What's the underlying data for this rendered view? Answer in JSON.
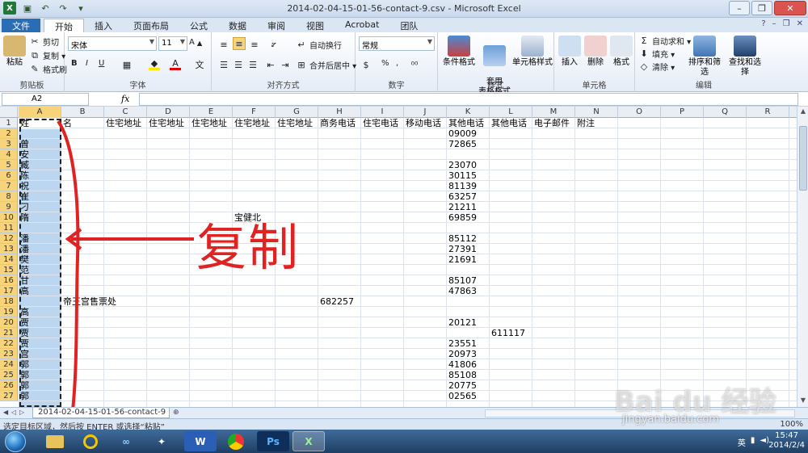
{
  "titlebar": {
    "title": "2014-02-04-15-01-56-contact-9.csv  -  Microsoft Excel",
    "app_icon": "X",
    "quick_access": [
      "save-icon",
      "undo-icon",
      "redo-icon",
      "customize-icon"
    ]
  },
  "ribbon_tabs": [
    "文件",
    "开始",
    "插入",
    "页面布局",
    "公式",
    "数据",
    "审阅",
    "视图",
    "Acrobat",
    "团队"
  ],
  "ribbon_active_tab": "开始",
  "ribbon": {
    "clipboard": {
      "name": "剪贴板",
      "paste": "粘贴",
      "cut": "剪切",
      "copy": "复制 ▾",
      "format_painter": "格式刷"
    },
    "font": {
      "name": "字体",
      "font_name": "宋体",
      "font_size": "11",
      "bold": "B",
      "italic": "I",
      "underline": "U"
    },
    "alignment": {
      "name": "对齐方式",
      "wrap": "自动换行",
      "merge": "合并后居中 ▾"
    },
    "number": {
      "name": "数字",
      "format": "常规",
      "percent": "%",
      "comma": ","
    },
    "styles": {
      "name": "样式",
      "conditional": "条件格式",
      "table": "套用\n表格格式",
      "cell_styles": "单元格样式"
    },
    "cells": {
      "name": "单元格",
      "insert": "插入",
      "delete": "删除",
      "format": "格式"
    },
    "editing": {
      "name": "编辑",
      "autosum": "自动求和 ▾",
      "fill": "填充 ▾",
      "clear": "清除 ▾",
      "sort": "排序和筛选",
      "find": "查找和选择"
    }
  },
  "formula_bar": {
    "name_box": "A2",
    "fx": "fx",
    "value": ""
  },
  "columns": [
    "A",
    "B",
    "C",
    "D",
    "E",
    "F",
    "G",
    "H",
    "I",
    "J",
    "K",
    "L",
    "M",
    "N",
    "O",
    "P",
    "Q",
    "R"
  ],
  "rows": [
    "1",
    "2",
    "3",
    "4",
    "5",
    "6",
    "7",
    "8",
    "9",
    "10",
    "11",
    "12",
    "13",
    "14",
    "15",
    "16",
    "17",
    "18",
    "19",
    "20",
    "21",
    "22",
    "23",
    "24",
    "25",
    "26",
    "27"
  ],
  "header_row": {
    "A": "姓",
    "B": "名",
    "C": "住宅地址",
    "D": "住宅地址",
    "E": "住宅地址",
    "F": "住宅地址",
    "G": "住宅地址",
    "H": "商务电话",
    "I": "住宅电话",
    "J": "移动电话",
    "K": "其他电话",
    "L": "其他电话",
    "M": "电子邮件",
    "N": "附注"
  },
  "col_a_values": [
    "",
    "曾",
    "安",
    "臧",
    "陈",
    "祝",
    "崔",
    "刁",
    "隋",
    "",
    "潘",
    "潘",
    "樊",
    "范",
    "甘",
    "高",
    "",
    "高",
    "贾",
    "贾",
    "贾",
    "宫",
    "郭",
    "郭",
    "郭",
    "郭"
  ],
  "visible_cells": [
    {
      "row": 2,
      "col": "K",
      "text": "09009"
    },
    {
      "row": 3,
      "col": "K",
      "text": "72865"
    },
    {
      "row": 5,
      "col": "K",
      "text": "23070"
    },
    {
      "row": 6,
      "col": "K",
      "text": "30115"
    },
    {
      "row": 7,
      "col": "K",
      "text": "81139"
    },
    {
      "row": 8,
      "col": "K",
      "text": "63257"
    },
    {
      "row": 9,
      "col": "K",
      "text": "21211"
    },
    {
      "row": 10,
      "col": "K",
      "text": "69859"
    },
    {
      "row": 10,
      "col": "F",
      "text": "宝健北"
    },
    {
      "row": 12,
      "col": "K",
      "text": "85112"
    },
    {
      "row": 13,
      "col": "K",
      "text": "27391"
    },
    {
      "row": 14,
      "col": "K",
      "text": "21691"
    },
    {
      "row": 16,
      "col": "K",
      "text": "85107"
    },
    {
      "row": 17,
      "col": "K",
      "text": "47863"
    },
    {
      "row": 18,
      "col": "B",
      "text": "帝王宫售票处"
    },
    {
      "row": 18,
      "col": "H",
      "text": "682257"
    },
    {
      "row": 20,
      "col": "K",
      "text": "20121"
    },
    {
      "row": 21,
      "col": "L",
      "text": "611117"
    },
    {
      "row": 22,
      "col": "K",
      "text": "23551"
    },
    {
      "row": 23,
      "col": "K",
      "text": "20973"
    },
    {
      "row": 24,
      "col": "K",
      "text": "41806"
    },
    {
      "row": 25,
      "col": "K",
      "text": "85108"
    },
    {
      "row": 26,
      "col": "K",
      "text": "20775"
    },
    {
      "row": 27,
      "col": "K",
      "text": "02565"
    }
  ],
  "annotation": {
    "label": "复制",
    "color": "#e12222"
  },
  "sheet_tab": "2014-02-04-15-01-56-contact-9",
  "status_text": "选定目标区域，然后按 ENTER 或选择“粘贴”",
  "zoom_level": "100%",
  "taskbar": {
    "apps": [
      "folder-icon",
      "ring-icon",
      "infinity-icon",
      "tool-icon",
      "W",
      "chrome-icon",
      "Ps",
      "X"
    ],
    "ime": "英",
    "time": "15:47",
    "date": "2014/2/4"
  },
  "watermark": {
    "brand": "Bai du 经验",
    "url": "jingyan.baidu.com"
  },
  "colors": {
    "accent": "#2a6db5",
    "selection": "#bcd6f0",
    "header_selected": "#f7d37a",
    "annotation": "#e12222"
  }
}
